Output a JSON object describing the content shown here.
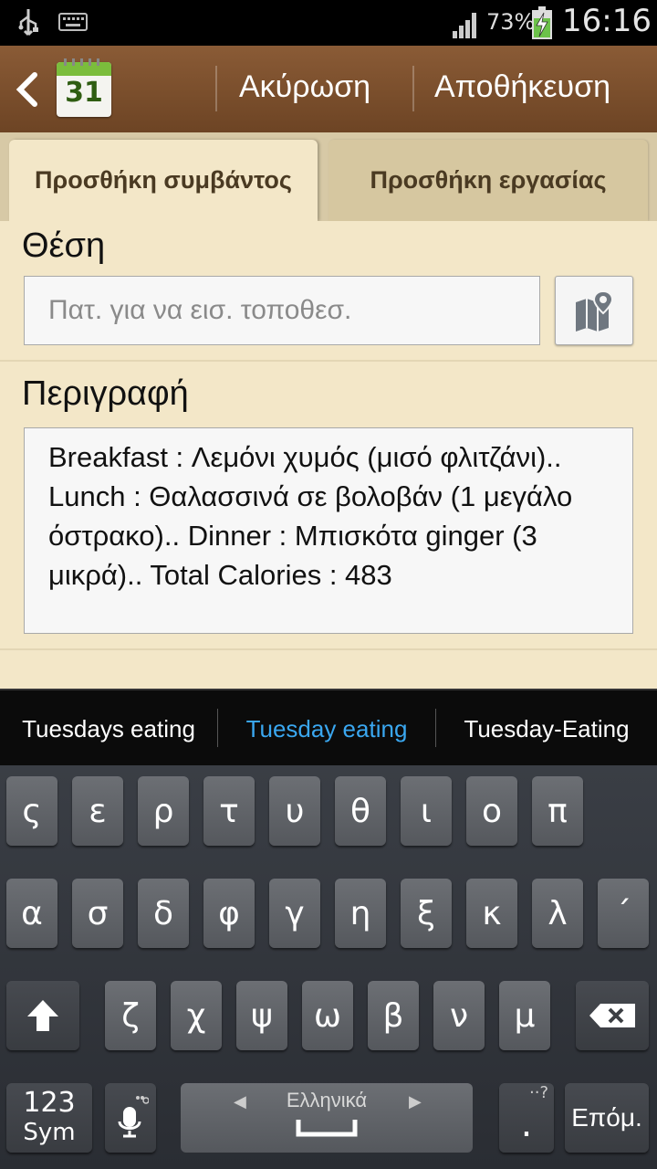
{
  "status_bar": {
    "battery_text": "73%",
    "time": "16:16",
    "icons": [
      "usb-icon",
      "keyboard-icon",
      "signal-icon",
      "battery-charging-icon"
    ]
  },
  "action_bar": {
    "calendar_day": "31",
    "cancel_label": "Ακύρωση",
    "save_label": "Αποθήκευση"
  },
  "tabs": [
    {
      "label": "Προσθήκη συμβάντος",
      "active": true
    },
    {
      "label": "Προσθήκη εργασίας",
      "active": false
    }
  ],
  "location": {
    "label": "Θέση",
    "placeholder": "Πατ. για να εισ. τοποθεσ."
  },
  "description": {
    "label": "Περιγραφή",
    "value": "Breakfast : Λεμόνι χυμός (μισό φλιτζάνι).. Lunch : Θαλασσινά σε βολοβάν (1 μεγάλο όστρακο).. Dinner : Μπισκότα ginger (3 μικρά).. Total Calories : 483"
  },
  "suggestions": [
    "Tuesdays eating",
    "Tuesday eating",
    "Tuesday-Eating"
  ],
  "keyboard": {
    "row1": [
      "ς",
      "ε",
      "ρ",
      "τ",
      "υ",
      "θ",
      "ι",
      "ο",
      "π"
    ],
    "row2": [
      "α",
      "σ",
      "δ",
      "φ",
      "γ",
      "η",
      "ξ",
      "κ",
      "λ",
      "´"
    ],
    "row3": [
      "ζ",
      "χ",
      "ψ",
      "ω",
      "β",
      "ν",
      "μ"
    ],
    "sym_top": "123",
    "sym_bottom": "Sym",
    "space_label": "Ελληνικά",
    "period": ".",
    "enter_label": "Επόμ.",
    "accent_color": "#3aa7f0"
  }
}
